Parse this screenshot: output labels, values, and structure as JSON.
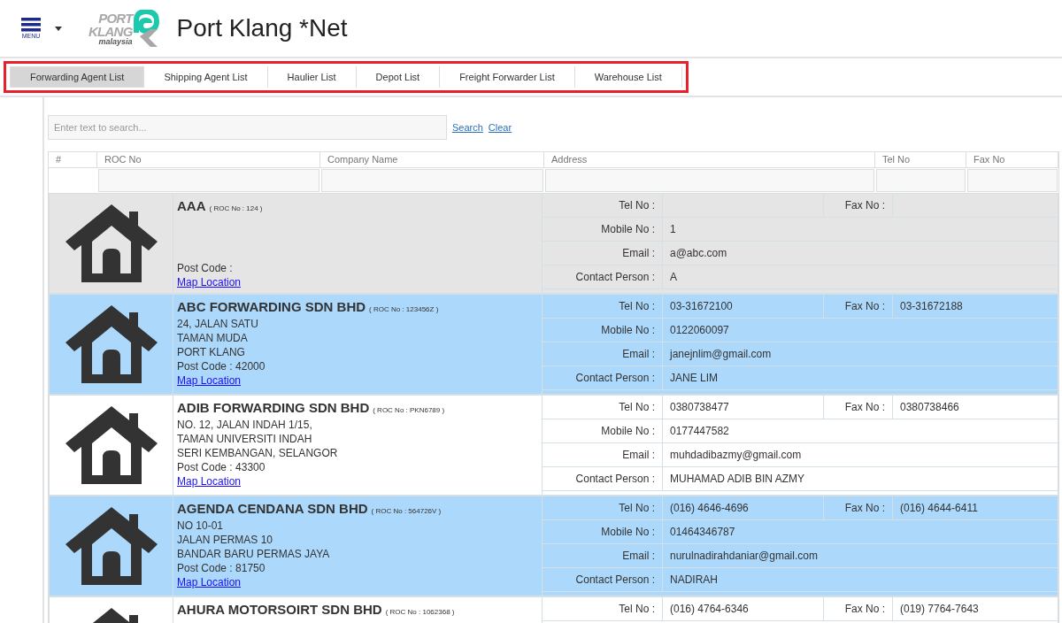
{
  "header": {
    "menu_label": "MENU",
    "logo": {
      "line1": "PORT",
      "line2": "KLANG",
      "tagline": "malaysia"
    },
    "title": "Port Klang *Net"
  },
  "tabs": [
    {
      "label": "Forwarding Agent List",
      "selected": true
    },
    {
      "label": "Shipping Agent List",
      "selected": false
    },
    {
      "label": "Haulier List",
      "selected": false
    },
    {
      "label": "Depot List",
      "selected": false
    },
    {
      "label": "Freight Forwarder List",
      "selected": false
    },
    {
      "label": "Warehouse List",
      "selected": false
    }
  ],
  "search": {
    "placeholder": "Enter text to search...",
    "search_link": "Search",
    "clear_link": "Clear"
  },
  "table": {
    "columns": [
      "#",
      "ROC No",
      "Company Name",
      "Address",
      "Tel No",
      "Fax No"
    ],
    "records": [
      {
        "color": "#e5e5e5",
        "name": "AAA",
        "roc": "( ROC No : 124 )",
        "post_code": "Post Code :",
        "map_link": "Map Location",
        "fields": [
          {
            "label": "Tel No :"
          },
          {
            "label": "Fax No :"
          },
          {
            "label": "Mobile No :",
            "value": "1"
          },
          {
            "label": "Email :",
            "value": "a@abc.com"
          },
          {
            "label": "Contact Person :",
            "value": "A"
          }
        ]
      },
      {
        "color": "#acd8fb",
        "name": "ABC FORWARDING SDN BHD",
        "roc": "( ROC No : 123456Z )",
        "address_lines": [
          "24, JALAN SATU",
          "TAMAN MUDA",
          "PORT KLANG"
        ],
        "post_code": "Post Code : 42000",
        "map_link": "Map Location",
        "fields": [
          {
            "label": "Tel No :",
            "value": "03-31672100"
          },
          {
            "label": "Fax No :",
            "value": "03-31672188"
          },
          {
            "label": "Mobile No :",
            "value": "0122060097"
          },
          {
            "label": "Email :",
            "value": "janejnlim@gmail.com"
          },
          {
            "label": "Contact Person :",
            "value": "JANE LIM"
          }
        ]
      },
      {
        "color": "#ffffff",
        "name": "ADIB FORWARDING SDN BHD",
        "roc": "( ROC No : PKN6789 )",
        "address_lines": [
          "NO. 12, JALAN INDAH 1/15,",
          "TAMAN UNIVERSITI INDAH",
          "SERI KEMBANGAN, SELANGOR"
        ],
        "post_code": "Post Code : 43300",
        "map_link": "Map Location",
        "fields": [
          {
            "label": "Tel No :",
            "value": "0380738477"
          },
          {
            "label": "Fax No :",
            "value": "0380738466"
          },
          {
            "label": "Mobile No :",
            "value": "0177447582"
          },
          {
            "label": "Email :",
            "value": "muhdadibazmy@gmail.com"
          },
          {
            "label": "Contact Person :",
            "value": "MUHAMAD ADIB BIN AZMY"
          }
        ]
      },
      {
        "color": "#acd8fb",
        "name": "AGENDA CENDANA SDN BHD",
        "roc": "( ROC No : 564726V )",
        "address_lines": [
          "NO 10-01",
          "JALAN PERMAS 10",
          "BANDAR BARU PERMAS JAYA"
        ],
        "post_code": "Post Code : 81750",
        "map_link": "Map Location",
        "fields": [
          {
            "label": "Tel No :",
            "value": "(016) 4646-4696"
          },
          {
            "label": "Fax No :",
            "value": "(016) 4644-6411"
          },
          {
            "label": "Mobile No :",
            "value": "01464346787"
          },
          {
            "label": "Email :",
            "value": "nurulnadirahdaniar@gmail.com"
          },
          {
            "label": "Contact Person :",
            "value": "NADIRAH"
          }
        ]
      },
      {
        "color": "#ffffff",
        "name": "AHURA MOTORSOIRT SDN BHD",
        "roc": "( ROC No : 1062368 )",
        "fields": [
          {
            "label": "Tel No :",
            "value": "(016) 4764-6346"
          },
          {
            "label": "Fax No :",
            "value": "(019) 7764-7643"
          }
        ]
      }
    ]
  }
}
